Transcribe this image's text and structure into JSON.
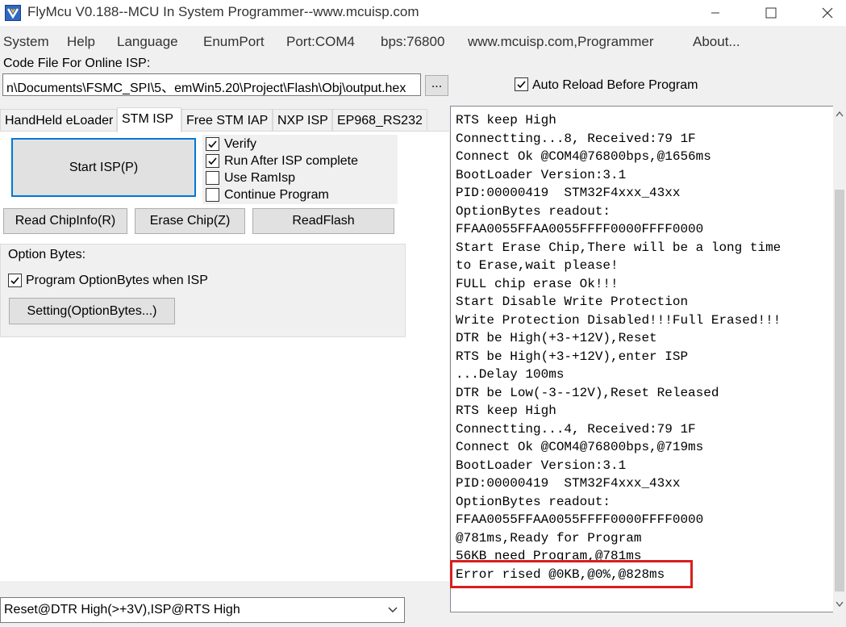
{
  "window": {
    "title": "FlyMcu V0.188--MCU In System Programmer--www.mcuisp.com",
    "icon": "flymcu-app-icon",
    "controls": [
      "minimize-icon",
      "maximize-icon",
      "close-icon"
    ]
  },
  "menu": {
    "items": [
      "System",
      "Help",
      "Language",
      "EnumPort",
      "Port:COM4",
      "bps:76800",
      "www.mcuisp.com,Programmer",
      "About..."
    ]
  },
  "code_file": {
    "label": "Code File For Online ISP:",
    "path": "n\\Documents\\FSMC_SPI\\5、emWin5.20\\Project\\Flash\\Obj\\output.hex",
    "browse_label": "...",
    "auto_reload_label": "Auto Reload Before Program",
    "auto_reload_checked": true
  },
  "tabs": {
    "items": [
      "HandHeld eLoader",
      "STM ISP",
      "Free STM IAP",
      "NXP ISP",
      "EP968_RS232"
    ],
    "active": "STM ISP"
  },
  "stm_isp": {
    "start_label": "Start ISP(P)",
    "verify_label": "Verify",
    "verify_checked": true,
    "run_after_label": "Run After ISP complete",
    "run_after_checked": true,
    "use_ramisp_label": "Use RamIsp",
    "use_ramisp_checked": false,
    "continue_label": "Continue Program",
    "continue_checked": false,
    "read_chipinfo_label": "Read ChipInfo(R)",
    "erase_chip_label": "Erase Chip(Z)",
    "readflash_label": "ReadFlash"
  },
  "option_bytes": {
    "group_label": "Option Bytes:",
    "program_label": "Program OptionBytes when ISP",
    "program_checked": true,
    "setting_label": "Setting(OptionBytes...)"
  },
  "bottom": {
    "mode_select_value": "Reset@DTR High(>+3V),ISP@RTS High"
  },
  "log": {
    "lines": [
      "RTS keep High",
      "Connectting...8, Received:79 1F",
      "Connect Ok @COM4@76800bps,@1656ms",
      "BootLoader Version:3.1",
      "PID:00000419  STM32F4xxx_43xx",
      "OptionBytes readout:",
      "FFAA0055FFAA0055FFFF0000FFFF0000",
      "Start Erase Chip,There will be a long time",
      "to Erase,wait please!",
      "FULL chip erase Ok!!!",
      "Start Disable Write Protection",
      "Write Protection Disabled!!!Full Erased!!!",
      "DTR be High(+3-+12V),Reset",
      "RTS be High(+3-+12V),enter ISP",
      "...Delay 100ms",
      "DTR be Low(-3--12V),Reset Released",
      "RTS keep High",
      "Connectting...4, Received:79 1F",
      "Connect Ok @COM4@76800bps,@719ms",
      "BootLoader Version:3.1",
      "PID:00000419  STM32F4xxx_43xx",
      "OptionBytes readout:",
      "FFAA0055FFAA0055FFFF0000FFFF0000",
      "@781ms,Ready for Program",
      "56KB need Program,@781ms",
      "Error rised @0KB,@0%,@828ms"
    ],
    "highlight_color": "#d81e1e"
  }
}
